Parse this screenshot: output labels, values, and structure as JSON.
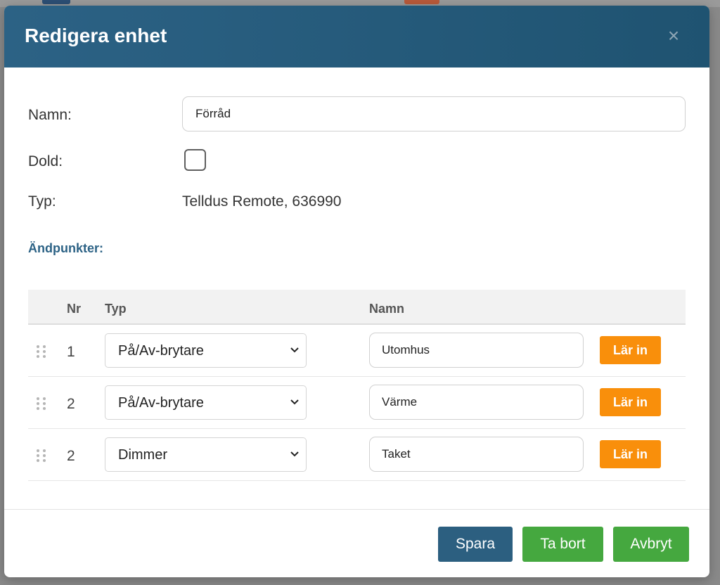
{
  "dialog": {
    "title": "Redigera enhet",
    "close_label": "×"
  },
  "form": {
    "name_label": "Namn:",
    "name_value": "Förråd",
    "hidden_label": "Dold:",
    "hidden_checked": false,
    "type_label": "Typ:",
    "type_value": "Telldus Remote, 636990"
  },
  "endpoints": {
    "title": "Ändpunkter:",
    "headers": {
      "nr": "Nr",
      "type": "Typ",
      "name": "Namn"
    },
    "rows": [
      {
        "nr": "1",
        "type": "På/Av-brytare",
        "name": "Utomhus",
        "action": "Lär in"
      },
      {
        "nr": "2",
        "type": "På/Av-brytare",
        "name": "Värme",
        "action": "Lär in"
      },
      {
        "nr": "2",
        "type": "Dimmer",
        "name": "Taket",
        "action": "Lär in"
      }
    ]
  },
  "footer": {
    "save_label": "Spara",
    "delete_label": "Ta bort",
    "cancel_label": "Avbryt"
  },
  "colors": {
    "header_bg": "#2c6285",
    "accent_blue": "#2c5f80",
    "learn_orange": "#f98f0b",
    "action_green": "#45a83f"
  },
  "icons": {
    "close": "close-icon",
    "drag": "drag-handle-icon",
    "select_arrow": "chevron-down-icon"
  }
}
